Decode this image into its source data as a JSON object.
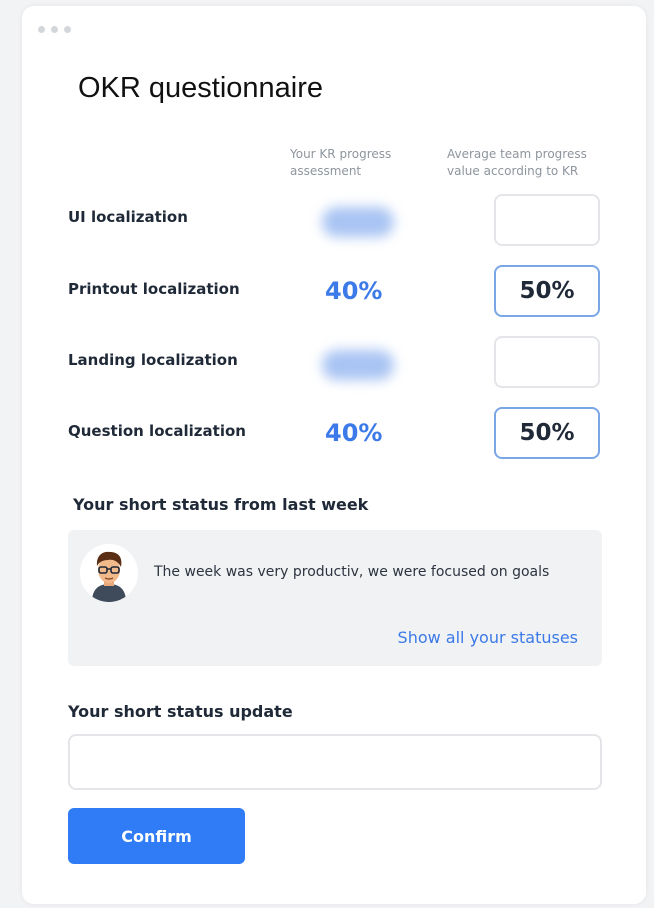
{
  "form": {
    "title": "OKR questionnaire",
    "columns": {
      "your_assessment": "Your KR progress assessment",
      "team_average": "Average team progress value according to KR"
    },
    "rows": [
      {
        "label": "UI localization",
        "your_value": null,
        "team_value": ""
      },
      {
        "label": "Printout localization",
        "your_value": "40%",
        "team_value": "50%"
      },
      {
        "label": "Landing localization",
        "your_value": null,
        "team_value": ""
      },
      {
        "label": "Question localization",
        "your_value": "40%",
        "team_value": "50%"
      }
    ]
  },
  "last_week": {
    "heading": "Your short status from last week",
    "status_text": "The week was very productiv, we were focused on goals",
    "show_all_link": "Show all your statuses"
  },
  "update": {
    "heading": "Your short status update",
    "input_value": "",
    "placeholder": ""
  },
  "actions": {
    "confirm_label": "Confirm"
  },
  "colors": {
    "accent": "#3b7ae8",
    "button": "#2f7cf6",
    "panel": "#f1f2f4"
  }
}
